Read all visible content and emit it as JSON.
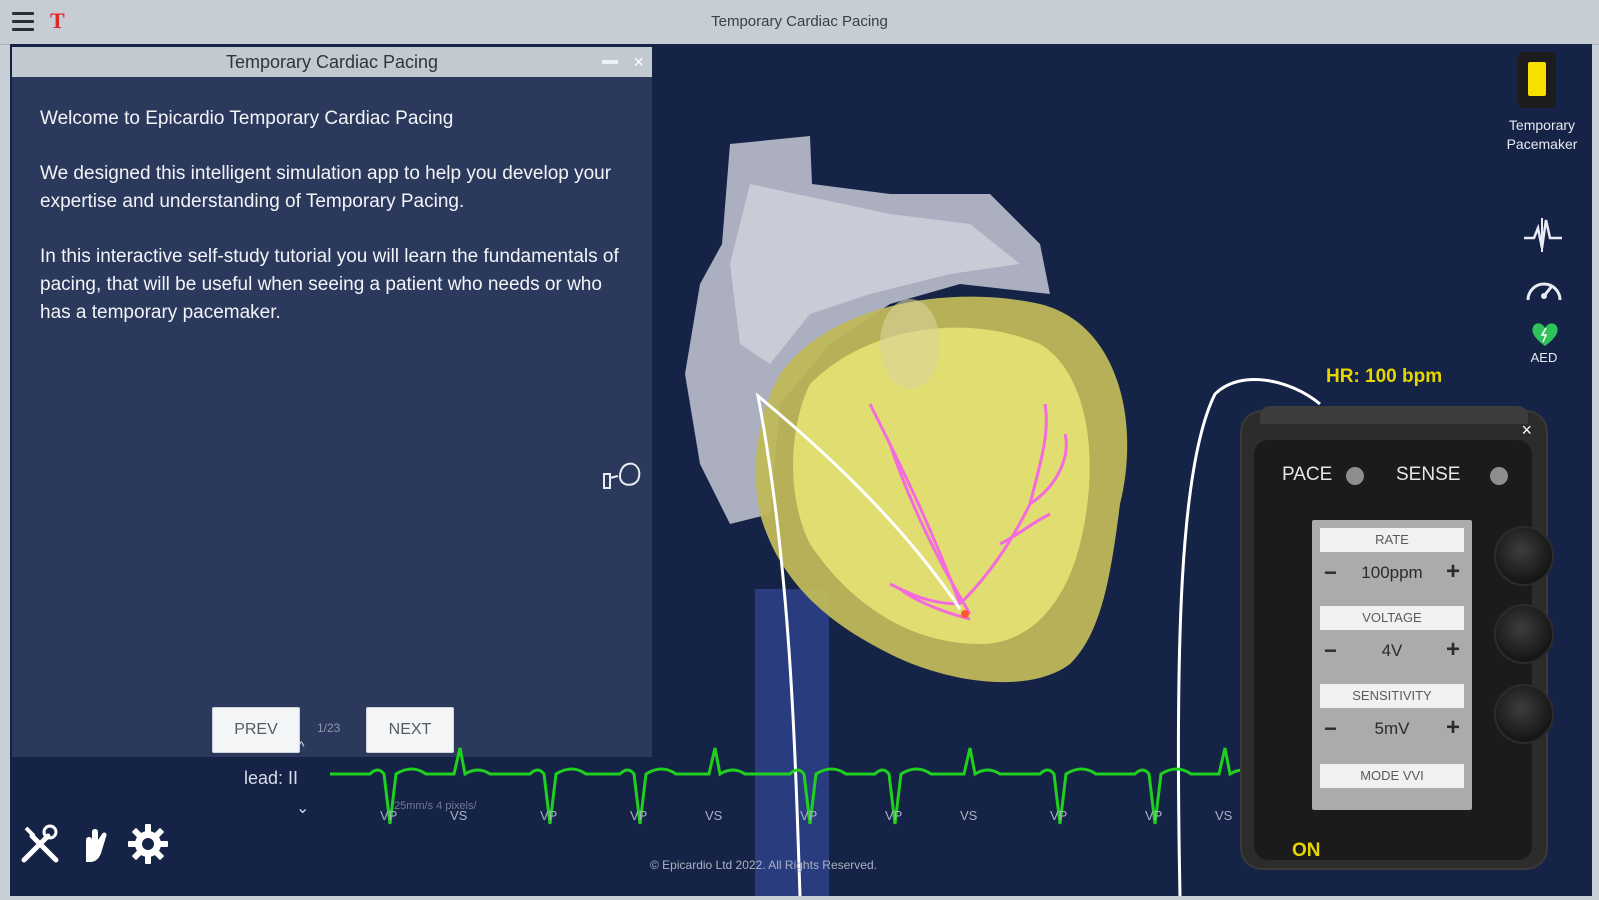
{
  "titlebar": {
    "logo": "T",
    "title": "Temporary Cardiac Pacing"
  },
  "tutorial": {
    "header": "Temporary Cardiac Pacing",
    "close_label": "×",
    "paragraphs": [
      "Welcome to Epicardio Temporary Cardiac Pacing",
      "We designed this intelligent simulation app to help you develop your expertise and understanding of Temporary Pacing.",
      "In this interactive self-study tutorial you will learn the fundamentals of pacing, that will be useful when seeing a patient who needs or who has a temporary pacemaker."
    ],
    "prev_label": "PREV",
    "next_label": "NEXT",
    "page_indicator": "1/23"
  },
  "right_tools": {
    "pacemaker_label_1": "Temporary",
    "pacemaker_label_2": "Pacemaker",
    "aed_label": "AED"
  },
  "hr_readout": "HR: 100 bpm",
  "device": {
    "close_label": "×",
    "pace_label": "PACE",
    "sense_label": "SENSE",
    "rate_header": "RATE",
    "rate_value": "100ppm",
    "voltage_header": "VOLTAGE",
    "voltage_value": "4V",
    "sensitivity_header": "SENSITIVITY",
    "sensitivity_value": "5mV",
    "mode_label": "MODE VVI",
    "on_label": "ON",
    "minus": "−",
    "plus": "+"
  },
  "ecg": {
    "lead_label": "lead: II",
    "up_arrow": "^",
    "down_arrow": "⌄",
    "scale_text": "25mm/s  4 pixels/",
    "beat_labels": [
      "VP",
      "VS",
      "VP",
      "VP",
      "VS",
      "VP",
      "VP",
      "VS",
      "VP",
      "VP",
      "VS"
    ],
    "colors": {
      "trace": "#1fd01f"
    }
  },
  "copyright": "© Epicardio Ltd 2022. All Rights Reserved."
}
